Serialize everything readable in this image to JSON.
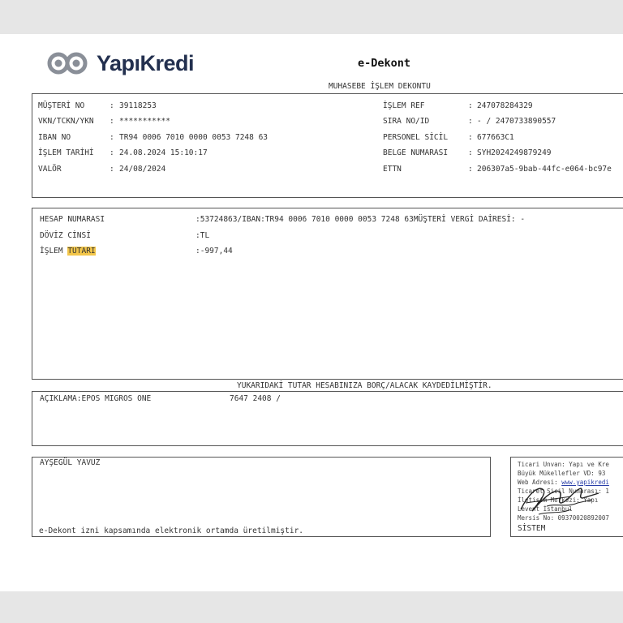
{
  "header": {
    "brand": "YapıKredi",
    "title": "e-Dekont",
    "subtitle": "MUHASEBE İŞLEM DEKONTU"
  },
  "info": {
    "left": [
      {
        "label": "MÜŞTERİ NO",
        "value": "39118253"
      },
      {
        "label": "VKN/TCKN/YKN",
        "value": "***********"
      },
      {
        "label": "IBAN NO",
        "value": "TR94 0006 7010 0000 0053 7248 63"
      },
      {
        "label": "İŞLEM TARİHİ",
        "value": "24.08.2024 15:10:17"
      },
      {
        "label": "VALÖR",
        "value": "24/08/2024"
      }
    ],
    "right": [
      {
        "label": "İŞLEM REF",
        "value": "247078284329"
      },
      {
        "label": "SIRA NO/ID",
        "value": "- / 2470733890557"
      },
      {
        "label": "PERSONEL SİCİL",
        "value": "677663C1"
      },
      {
        "label": "BELGE NUMARASI",
        "value": "SYH2024249879249"
      },
      {
        "label": "ETTN",
        "value": "206307a5-9bab-44fc-e064-bc97e"
      }
    ],
    "separator": ":"
  },
  "account": {
    "rows": [
      {
        "label": "HESAP NUMARASI",
        "value": ":53724863/IBAN:TR94 0006 7010 0000 0053 7248 63MÜŞTERİ VERGİ DAİRESİ: -"
      },
      {
        "label": "DÖVİZ CİNSİ",
        "value": ":TL"
      }
    ],
    "amount_label_a": "İŞLEM ",
    "amount_label_b": "TUTARI",
    "amount_value": ":-997,44"
  },
  "notice": "YUKARIDAKİ TUTAR HESABINIZA BORÇ/ALACAK KAYDEDİLMİŞTİR.",
  "description": {
    "label": "AÇIKLAMA:EPOS MIGROS ONE",
    "value": "7647 2408 /"
  },
  "signer": {
    "name": "AYŞEGÜL YAVUZ",
    "footer": "e-Dekont izni kapsamında elektronik ortamda üretilmiştir."
  },
  "bank_info": {
    "line1": "Ticari Unvan: Yapı ve Kre",
    "line2": "Büyük Mükellefler VD: 93",
    "line3_a": "Web Adresi: ",
    "line3_b": "www.yapikredi",
    "line4": "Ticaret Sicil Numarası: 1",
    "line5": "İletişim Merkezi: Yapı",
    "line6": "Levent İstanbul",
    "line7": "Mersis No: 09370020892007",
    "system": "SİSTEM"
  },
  "colors": {
    "highlight": "#f3c64a",
    "brand_text": "#23304f",
    "border": "#555555"
  }
}
